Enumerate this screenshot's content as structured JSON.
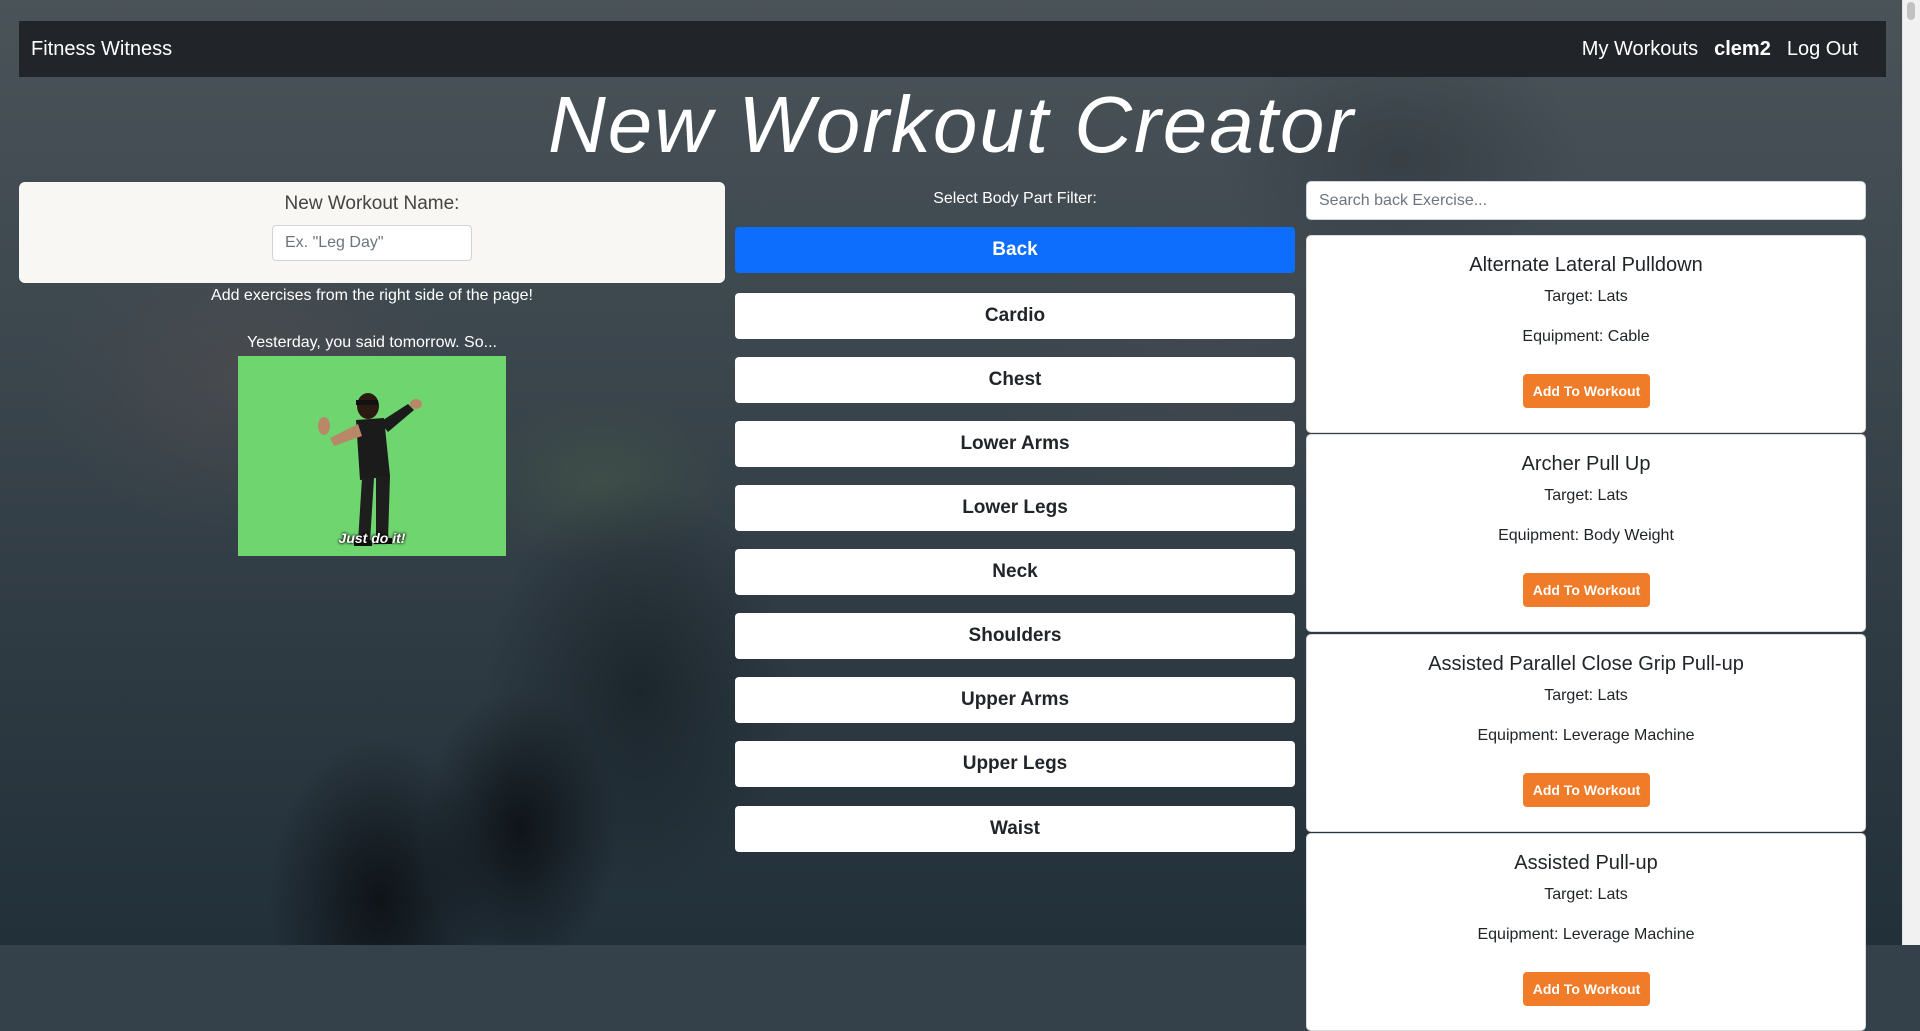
{
  "navbar": {
    "brand": "Fitness Witness",
    "links": {
      "my_workouts": "My Workouts",
      "user": "clem2",
      "logout": "Log Out"
    }
  },
  "page_title": "New Workout Creator",
  "workout_form": {
    "label": "New Workout Name:",
    "placeholder": "Ex. \"Leg Day\"",
    "hint": "Add exercises from the right side of the page!"
  },
  "motivation": {
    "quote": "Yesterday, you said tomorrow. So...",
    "gif_caption": "Just do it!"
  },
  "body_part_filter": {
    "title": "Select Body Part Filter:",
    "selected": "Back",
    "options": [
      "Back",
      "Cardio",
      "Chest",
      "Lower Arms",
      "Lower Legs",
      "Neck",
      "Shoulders",
      "Upper Arms",
      "Upper Legs",
      "Waist"
    ]
  },
  "search": {
    "placeholder": "Search back Exercise..."
  },
  "exercises": [
    {
      "name": "Alternate Lateral Pulldown",
      "target": "Target: Lats",
      "equipment": "Equipment: Cable",
      "button": "Add To Workout"
    },
    {
      "name": "Archer Pull Up",
      "target": "Target: Lats",
      "equipment": "Equipment: Body Weight",
      "button": "Add To Workout"
    },
    {
      "name": "Assisted Parallel Close Grip Pull-up",
      "target": "Target: Lats",
      "equipment": "Equipment: Leverage Machine",
      "button": "Add To Workout"
    },
    {
      "name": "Assisted Pull-up",
      "target": "Target: Lats",
      "equipment": "Equipment: Leverage Machine",
      "button": "Add To Workout"
    }
  ],
  "colors": {
    "navbar": "#212529",
    "active_filter": "#0d6efd",
    "add_button": "#f07b28",
    "gif_background": "#6fd66f"
  }
}
